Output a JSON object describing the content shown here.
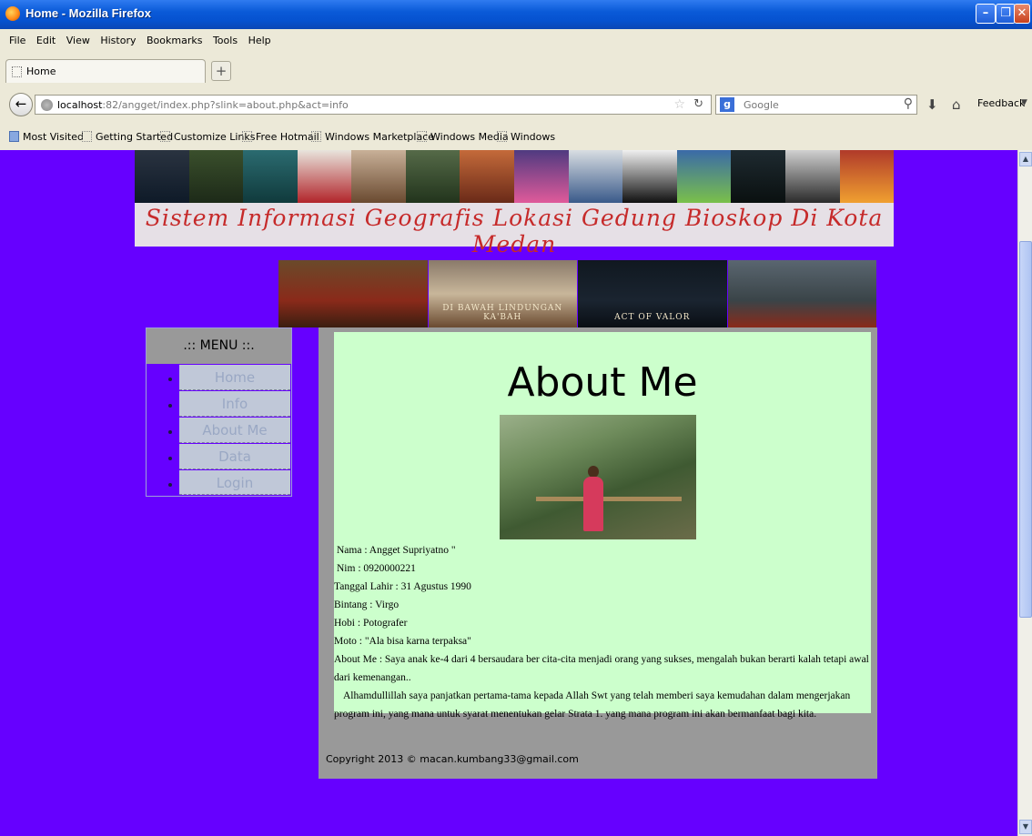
{
  "window": {
    "title": "Home - Mozilla Firefox"
  },
  "menubar": [
    "File",
    "Edit",
    "View",
    "History",
    "Bookmarks",
    "Tools",
    "Help"
  ],
  "tab": {
    "label": "Home",
    "new_tab": "+"
  },
  "nav": {
    "url_host": "localhost",
    "url_rest": ":82/angget/index.php?slink=about.php&act=info",
    "search_placeholder": "Google",
    "feedback": "Feedback"
  },
  "bookmarks": [
    "Most Visited",
    "Getting Started",
    "Customize Links",
    "Free Hotmail",
    "Windows Marketplace",
    "Windows Media",
    "Windows"
  ],
  "site": {
    "title": "Sistem Informasi Geografis Lokasi Gedung Bioskop Di Kota Medan",
    "feature_posters": [
      "",
      "DI BAWAH LINDUNGAN KA'BAH",
      "ACT OF VALOR",
      ""
    ]
  },
  "menu": {
    "heading": ".:: MENU ::.",
    "items": [
      "Home",
      "Info",
      "About Me",
      "Data",
      "Login"
    ]
  },
  "about": {
    "heading": "About Me",
    "lines": [
      "Nama : Angget Supriyatno \"",
      "Nim : 0920000221",
      "Tanggal Lahir : 31 Agustus 1990",
      "Bintang : Virgo",
      "Hobi : Potografer",
      "Moto : \"Ala bisa karna terpaksa\""
    ],
    "about_text": "About Me : Saya anak ke-4 dari 4 bersaudara ber cita-cita menjadi orang yang sukses, mengalah bukan berarti kalah tetapi awal dari kemenangan..",
    "thanks_text": "Alhamdullillah saya panjatkan pertama-tama kepada Allah Swt yang telah memberi saya kemudahan dalam mengerjakan program ini, yang mana untuk syarat menentukan gelar Strata 1. yang mana program ini akan bermanfaat bagi kita."
  },
  "footer": {
    "copyright": "Copyright 2013 © macan.kumbang33@gmail.com"
  }
}
